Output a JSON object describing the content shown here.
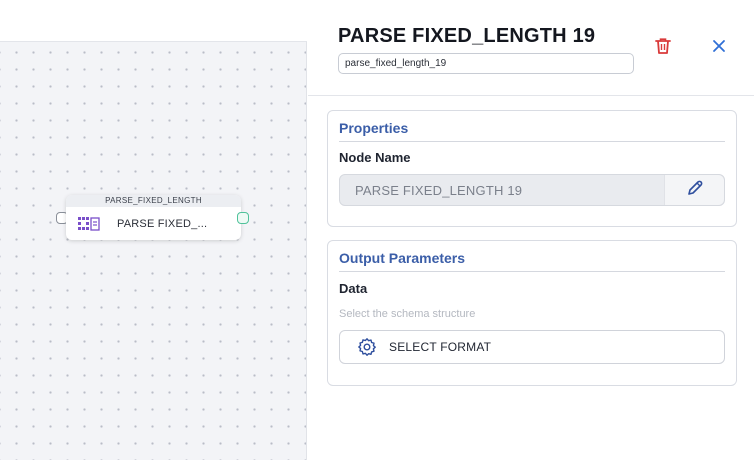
{
  "canvas": {
    "node": {
      "type_label": "PARSE_FIXED_LENGTH",
      "name": "PARSE FIXED_..."
    }
  },
  "panel": {
    "title": "PARSE FIXED_LENGTH 19",
    "node_id": "parse_fixed_length_19",
    "properties": {
      "section_title": "Properties",
      "node_name_label": "Node Name",
      "node_name_value": "PARSE FIXED_LENGTH 19"
    },
    "output_parameters": {
      "section_title": "Output Parameters",
      "data_label": "Data",
      "hint": "Select the schema structure",
      "select_format_label": "SELECT FORMAT"
    }
  },
  "colors": {
    "accent_blue": "#3b5ea8",
    "delete_red": "#d93a3a",
    "close_blue": "#2f6fd6",
    "port_green": "#4fc29a",
    "node_icon_purple": "#7a4fc9"
  },
  "icons": {
    "node": "parser-grid-icon",
    "delete": "trash-icon",
    "close": "close-icon",
    "edit": "pencil-icon",
    "format": "gear-icon"
  }
}
